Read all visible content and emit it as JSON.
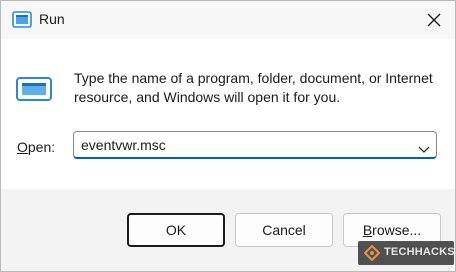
{
  "window": {
    "title": "Run",
    "close_icon": "close-icon",
    "app_icon": "run-icon"
  },
  "dialog": {
    "message": "Type the name of a program, folder, document, or Internet resource, and Windows will open it for you.",
    "open_label_accel": "O",
    "open_label_rest": "pen:",
    "input_value": "eventvwr.msc",
    "dropdown_icon": "chevron-down-icon"
  },
  "buttons": {
    "ok": "OK",
    "cancel": "Cancel",
    "browse_accel": "B",
    "browse_rest": "rowse..."
  },
  "watermark": {
    "text": "TECHHACKS"
  },
  "colors": {
    "accent": "#005fb8",
    "icon_blue": "#2b88d8"
  }
}
